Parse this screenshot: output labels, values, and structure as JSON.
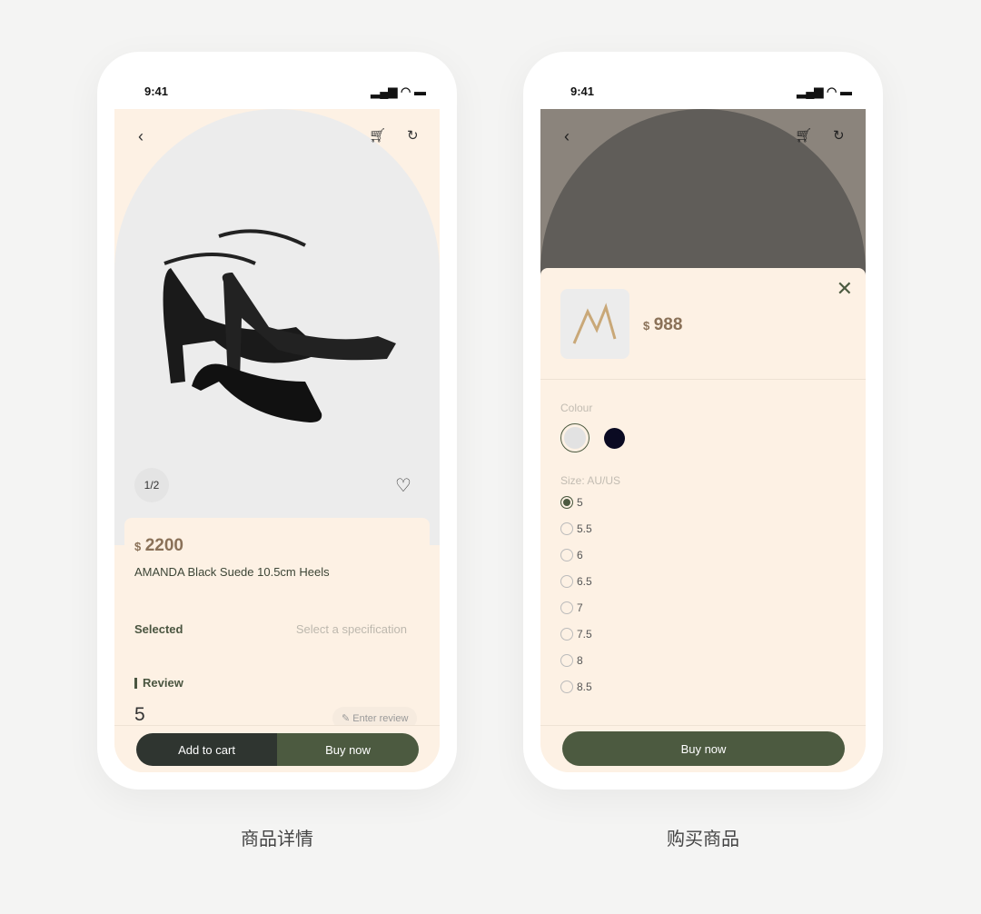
{
  "status": {
    "time": "9:41",
    "signal": "signal-icon",
    "wifi": "wifi-icon",
    "battery": "battery-icon"
  },
  "detail": {
    "caption": "商品详情",
    "image_counter": "1/2",
    "currency": "$",
    "price": "2200",
    "name": "AMANDA Black Suede 10.5cm Heels",
    "selected_label": "Selected",
    "selected_value": "Select a specification",
    "review_label": "Review",
    "rating": "5",
    "enter_review": "Enter review",
    "add_to_cart": "Add to cart",
    "buy_now": "Buy now"
  },
  "purchase": {
    "caption": "购买商品",
    "currency": "$",
    "price": "988",
    "colour_label": "Colour",
    "colours": [
      "#e2e2e2",
      "#0a0a22"
    ],
    "size_label": "Size: AU/US",
    "sizes": [
      "5",
      "5.5",
      "6",
      "6.5",
      "7",
      "7.5",
      "8",
      "8.5"
    ],
    "selected_size": "5",
    "buy_now": "Buy now"
  },
  "colors": {
    "accent": "#4c5a40",
    "dark": "#2f3530",
    "background": "#fdf1e4",
    "price": "#8a7158"
  }
}
